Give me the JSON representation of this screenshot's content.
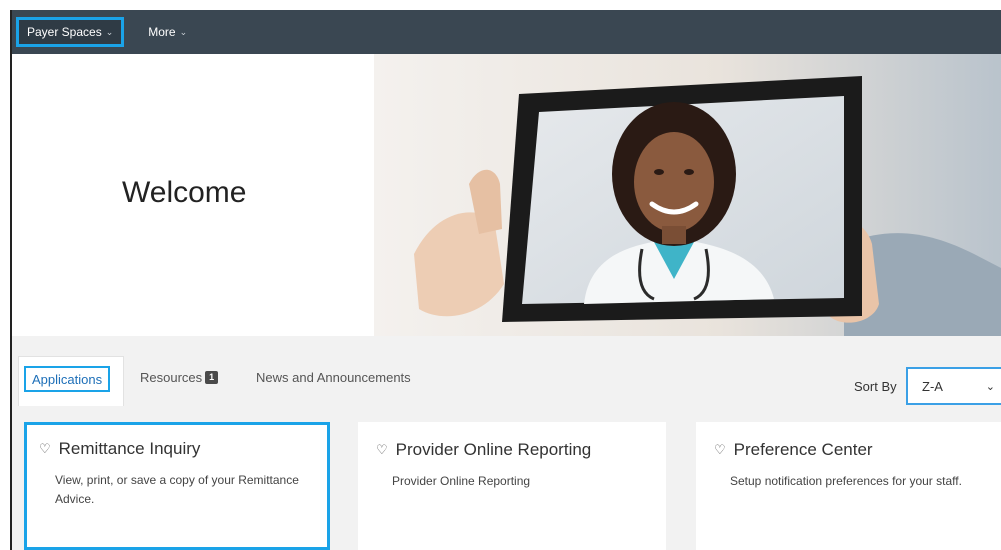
{
  "nav": {
    "payer_spaces": "Payer Spaces",
    "more": "More"
  },
  "hero": {
    "welcome": "Welcome"
  },
  "tabs": {
    "applications": "Applications",
    "resources": "Resources",
    "resources_badge": "1",
    "news": "News and Announcements"
  },
  "sort": {
    "label": "Sort By",
    "value": "Z-A"
  },
  "cards": [
    {
      "title": "Remittance Inquiry",
      "desc": "View, print, or save a copy of your Remittance Advice."
    },
    {
      "title": "Provider Online Reporting",
      "desc": "Provider Online Reporting"
    },
    {
      "title": "Preference Center",
      "desc": "Setup notification preferences for your staff."
    }
  ],
  "colors": {
    "nav_bg": "#3a4752",
    "highlight": "#1aa3e8",
    "active_tab_text": "#1d6fb8"
  },
  "icons": {
    "chevron": "chevron-down-icon",
    "favorite": "heart-icon",
    "sort_caret": "caret-down-icon"
  }
}
